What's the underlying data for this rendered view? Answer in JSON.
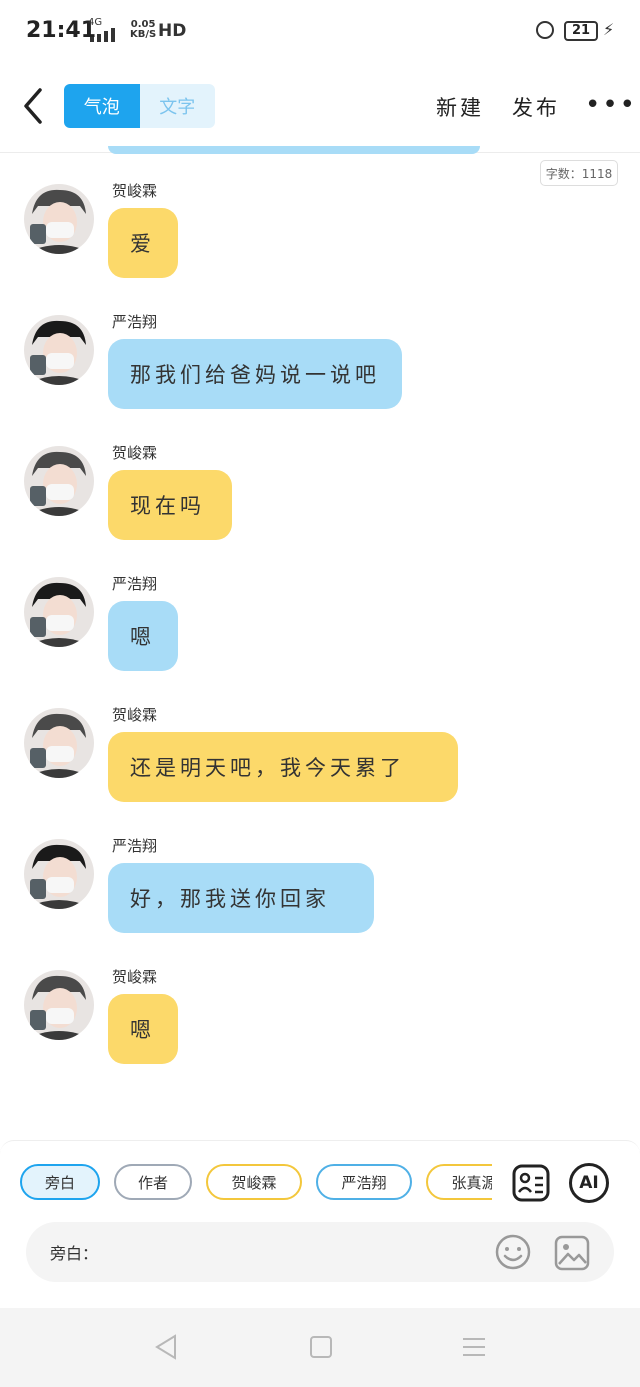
{
  "status_bar": {
    "time": "21:41",
    "network_type": "4G",
    "speed_value": "0.05",
    "speed_unit": "KB/S",
    "hd_label": "HD",
    "battery": "21"
  },
  "header": {
    "tab_bubble": "气泡",
    "tab_text": "文字",
    "new_label": "新建",
    "publish_label": "发布",
    "more_label": "•••"
  },
  "word_count": "字数：1118",
  "messages": [
    {
      "sender": "贺峻霖",
      "text": "爱",
      "color": "#fcd96a"
    },
    {
      "sender": "严浩翔",
      "text": "那我们给爸妈说一说吧",
      "color": "#a8dcf7"
    },
    {
      "sender": "贺峻霖",
      "text": "现在吗",
      "color": "#fcd96a"
    },
    {
      "sender": "严浩翔",
      "text": "嗯",
      "color": "#a8dcf7"
    },
    {
      "sender": "贺峻霖",
      "text": "还是明天吧，我今天累了",
      "color": "#fcd96a"
    },
    {
      "sender": "严浩翔",
      "text": "好，那我送你回家",
      "color": "#a8dcf7"
    },
    {
      "sender": "贺峻霖",
      "text": "嗯",
      "color": "#fcd96a"
    }
  ],
  "roles": [
    "旁白",
    "作者",
    "贺峻霖",
    "严浩翔",
    "张真源"
  ],
  "input": {
    "label": "旁白：",
    "value": "",
    "placeholder": ""
  },
  "tools": {
    "ai_label": "AI"
  },
  "icons": [
    "back-icon",
    "role-card-icon",
    "emoji-icon",
    "image-icon",
    "alarm-icon",
    "battery-icon",
    "nav-back-icon",
    "nav-home-icon",
    "nav-menu-icon"
  ]
}
